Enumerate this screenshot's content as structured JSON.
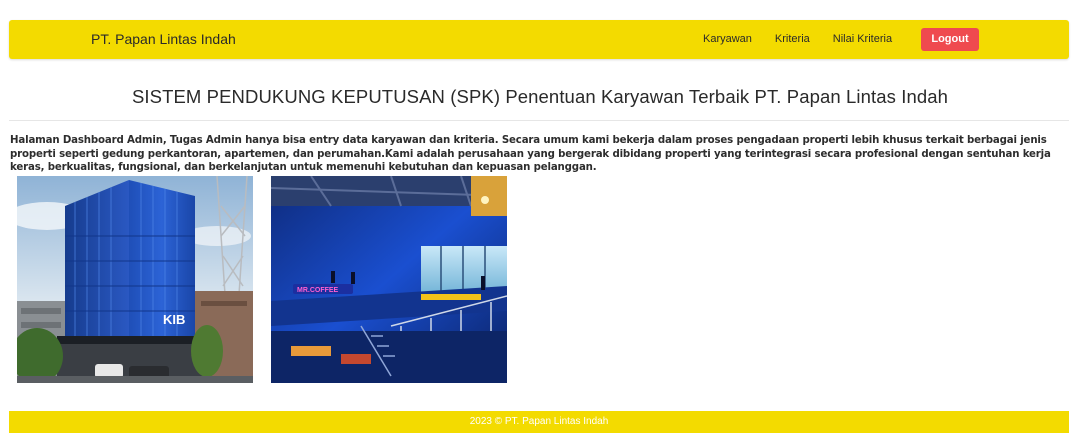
{
  "navbar": {
    "brand": "PT. Papan Lintas Indah",
    "links": [
      "Karyawan",
      "Kriteria",
      "Nilai Kriteria"
    ],
    "logout_label": "Logout",
    "background_color": "#f3db00",
    "logout_color": "#ef4a4f"
  },
  "main": {
    "title": "SISTEM PENDUKUNG KEPUTUSAN (SPK) Penentuan Karyawan Terbaik PT. Papan Lintas Indah",
    "description": "Halaman Dashboard Admin, Tugas Admin hanya bisa entry data karyawan dan kriteria. Secara umum kami bekerja dalam proses pengadaan properti lebih khusus terkait berbagai jenis properti seperti gedung perkantoran, apartemen, dan perumahan.Kami adalah perusahaan yang bergerak dibidang properti yang terintegrasi secara profesional dengan sentuhan kerja keras, berkualitas, fungsional, dan berkelanjutan untuk memenuhi kebutuhan dan kepuasan pelanggan.",
    "images": [
      {
        "sign_text": "KIB"
      },
      {
        "sign_text": "MR.COFFEE"
      }
    ]
  },
  "footer": {
    "text": "2023 © PT. Papan Lintas Indah"
  }
}
